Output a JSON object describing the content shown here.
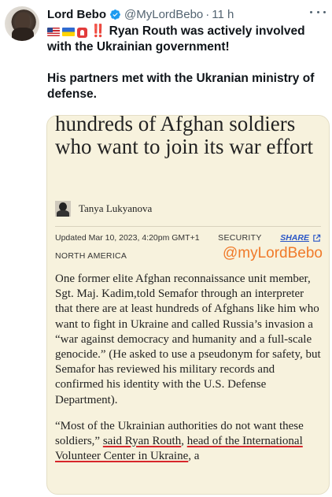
{
  "post": {
    "author_name": "Lord Bebo",
    "handle": "@MyLordBebo",
    "separator": "·",
    "time": "11 h",
    "text_line1": "Ryan Routh was actively involved with the Ukrainian government!",
    "text_line2": "His partners met with the Ukranian ministry of defense.",
    "emoji_prefix": "‼️"
  },
  "article": {
    "headline": "hundreds of Afghan soldiers who want to join its war effort",
    "author": "Tanya Lukyanova",
    "updated": "Updated Mar 10, 2023, 4:20pm GMT+1",
    "section": "SECURITY",
    "share_label": "SHARE",
    "region": "NORTH AMERICA",
    "watermark": "@myLordBebo",
    "paragraph1": "One former elite Afghan reconnaissance unit member, Sgt. Maj. Kadim,told Semafor through an interpreter that there are at least hundreds of Afghans like him who want to fight in Ukraine and called Russia’s invasion a “war against democracy and humanity and a full-scale genocide.” (He asked to use a pseudonym for safety, but Semafor has reviewed his military records and confirmed his identity with the U.S. Defense Department).",
    "p2_start": "“Most of the Ukrainian authorities do not want these soldiers,” ",
    "p2_said": "said Ryan Routh",
    "p2_comma": ", ",
    "p2_head": "head of the International Volunteer Center in Ukraine",
    "p2_end": ", a"
  },
  "colors": {
    "verified_blue": "#1d9bf0",
    "card_background": "#f7f2dd",
    "watermark_orange": "#f07a2a",
    "underline_red": "#d7262b",
    "share_blue": "#2a56c6"
  },
  "icons": [
    "verified-badge-icon",
    "more-options-icon",
    "us-flag-icon",
    "ukraine-flag-icon",
    "siren-icon",
    "share-external-icon"
  ]
}
